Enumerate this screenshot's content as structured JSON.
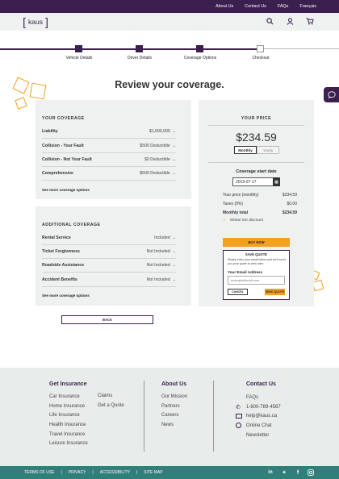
{
  "topnav": {
    "about": "About Us",
    "contact": "Contact Us",
    "faqs": "FAQs",
    "lang": "Français"
  },
  "header": {
    "logo": "kaus"
  },
  "steps": [
    {
      "label": "Vehicle Details"
    },
    {
      "label": "Driver Details"
    },
    {
      "label": "Coverage Options"
    },
    {
      "label": "Checkout"
    }
  ],
  "page_title": "Review your coverage.",
  "your_coverage": {
    "title": "YOUR COVERAGE",
    "rows": [
      {
        "label": "Liability",
        "value": "$1,000,000"
      },
      {
        "label": "Collision - Your Fault",
        "value": "$500 Deductible"
      },
      {
        "label": "Collision - Not Your Fault",
        "value": "$0 Deductible"
      },
      {
        "label": "Comprehensive",
        "value": "$500 Deductible"
      }
    ],
    "more": "See more coverage options"
  },
  "additional_coverage": {
    "title": "ADDITIONAL COVERAGE",
    "rows": [
      {
        "label": "Rental Service",
        "value": "Included"
      },
      {
        "label": "Ticket Forgiveness",
        "value": "Not Included"
      },
      {
        "label": "Roadside Assistance",
        "value": "Not Included"
      },
      {
        "label": "Accident Benefits",
        "value": "Not Included"
      }
    ],
    "more": "See more coverage options"
  },
  "back": "BACK",
  "your_price": {
    "title": "YOUR PRICE",
    "price": "$234.59",
    "monthly": "Monthly",
    "yearly": "Yearly",
    "start_label": "Coverage start date",
    "start_date": "2019-07-17",
    "lines": [
      {
        "label": "Your price (monthly)",
        "value": "$234.59"
      },
      {
        "label": "Taxes (0%)",
        "value": "$0.00"
      },
      {
        "label": "Monthly total",
        "value": "$234.59"
      }
    ],
    "discount": "Winter tire discount",
    "buy": "BUY NOW",
    "save_title": "SAVE QUOTE",
    "save_text": "Simply enter your email below and we'll send you your quote to view later.",
    "email_label": "Your Email Address",
    "email_placeholder": "example@mail.com",
    "cancel": "CANCEL",
    "send": "SEND QUOTE"
  },
  "footer": {
    "get_insurance": {
      "title": "Get Insurance",
      "col1": [
        "Car Insurance",
        "Home Insurance",
        "Life Insurance",
        "Health Insurance",
        "Travel Insurance",
        "Leisure Insurance"
      ],
      "col2": [
        "Claims",
        "Get a Quote"
      ]
    },
    "about": {
      "title": "About Us",
      "links": [
        "Our Mission",
        "Partners",
        "Careers",
        "News"
      ]
    },
    "contact": {
      "title": "Contact Us",
      "faqs": "FAQs",
      "phone": "1-800-789-4567",
      "email": "help@kaus.ca",
      "chat": "Online Chat",
      "newsletter": "Newsletter"
    }
  },
  "bottom": {
    "terms": "TERMS OF USE",
    "privacy": "PRIVACY",
    "accessibility": "ACCESSIBILITY",
    "sitemap": "SITE MAP"
  }
}
